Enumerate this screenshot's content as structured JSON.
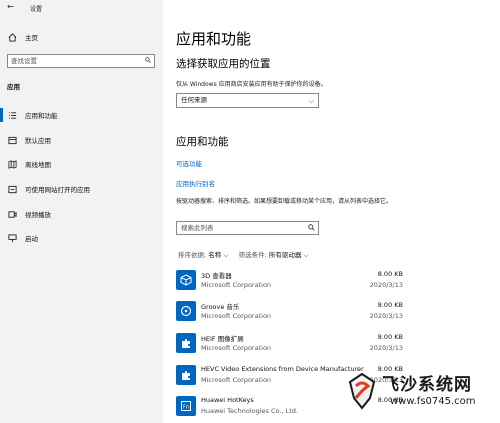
{
  "window": {
    "title": "设置"
  },
  "sidebar": {
    "home": "主页",
    "search_placeholder": "查找设置",
    "section": "应用",
    "items": [
      {
        "label": "应用和功能",
        "icon": "list-icon"
      },
      {
        "label": "默认应用",
        "icon": "default-apps-icon"
      },
      {
        "label": "离线地图",
        "icon": "map-icon"
      },
      {
        "label": "可使用网站打开的应用",
        "icon": "website-icon"
      },
      {
        "label": "视频播放",
        "icon": "video-icon"
      },
      {
        "label": "启动",
        "icon": "startup-icon"
      }
    ]
  },
  "main": {
    "title": "应用和功能",
    "choose_title": "选择获取应用的位置",
    "choose_desc": "仅从 Windows 应用商店安装应用有助于保护你的设备。",
    "source_value": "任何来源",
    "apps_title": "应用和功能",
    "optional_features": "可选功能",
    "app_aliases": "应用执行别名",
    "search_desc": "按驱动器搜索、排序和筛选。如果想要卸载或移动某个应用，请从列表中选择它。",
    "search_placeholder": "搜索此列表",
    "sort_label": "排序依据:",
    "sort_value": "名称",
    "filter_label": "筛选条件:",
    "filter_value": "所有驱动器",
    "apps": [
      {
        "name": "3D 查看器",
        "publisher": "Microsoft Corporation",
        "size": "8.00 KB",
        "date": "2020/3/13",
        "icon": "cube-icon"
      },
      {
        "name": "Groove 音乐",
        "publisher": "Microsoft Corporation",
        "size": "8.00 KB",
        "date": "2020/3/13",
        "icon": "disc-icon"
      },
      {
        "name": "HEIF 图像扩展",
        "publisher": "Microsoft Corporation",
        "size": "8.00 KB",
        "date": "2020/3/13",
        "icon": "puzzle-icon"
      },
      {
        "name": "HEVC Video Extensions from Device Manufacturer",
        "publisher": "Microsoft Corporation",
        "size": "8.00 KB",
        "date": "2020/3/13",
        "icon": "puzzle-icon"
      },
      {
        "name": "Huawei HotKeys",
        "publisher": "Huawei Technologies Co., Ltd.",
        "size": "8.00 KB",
        "date": "",
        "icon": "fn-key-icon"
      }
    ]
  },
  "watermark": {
    "text": "飞沙系统网",
    "url": "www.fs0745.com"
  },
  "colors": {
    "accent": "#0067c0",
    "sidebar_bg": "#f2f2f2"
  }
}
